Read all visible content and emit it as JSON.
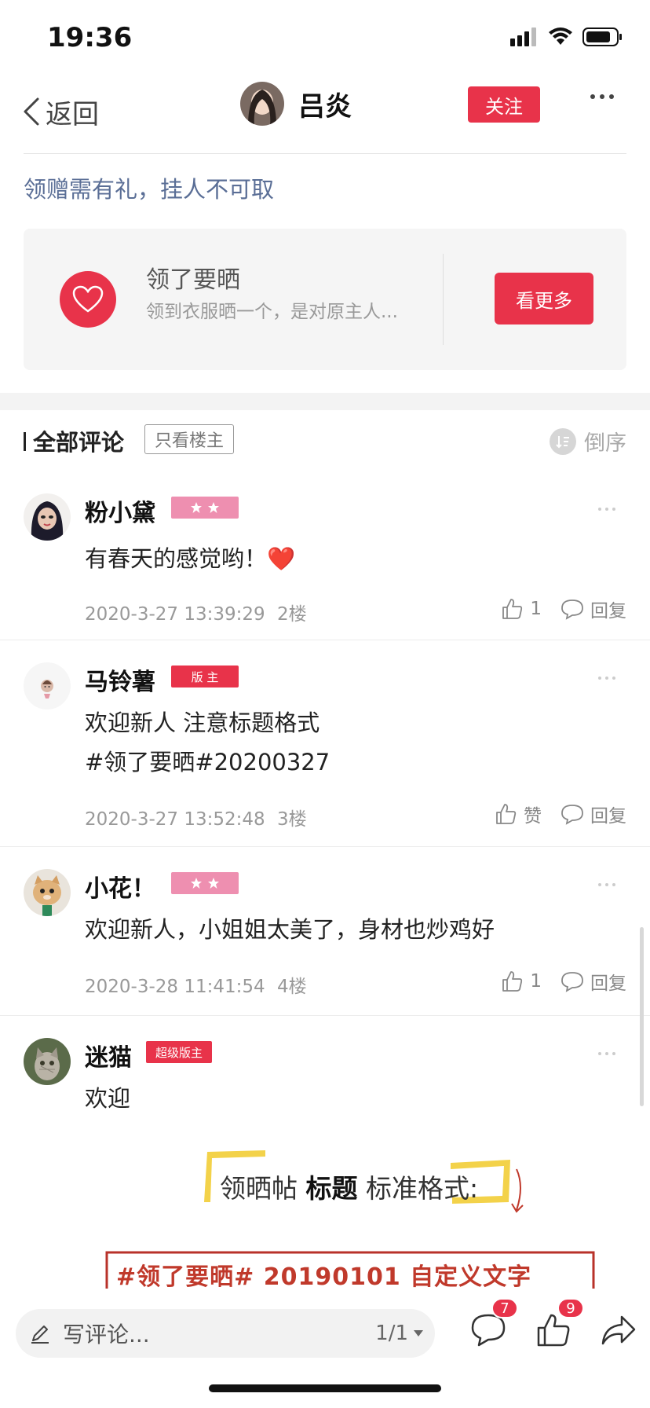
{
  "status_bar": {
    "time": "19:36"
  },
  "nav": {
    "back_label": "返回",
    "user_name": "吕炎",
    "follow_label": "关注"
  },
  "notice": "领赠需有礼，挂人不可取",
  "promo": {
    "title": "领了要晒",
    "description": "领到衣服晒一个，是对原主人...",
    "button_label": "看更多"
  },
  "comments_header": {
    "title": "全部评论",
    "filter_label": "只看楼主",
    "sort_label": "倒序"
  },
  "comments": [
    {
      "name": "粉小黛",
      "badge": "",
      "stars": 2,
      "lines": [
        "有春天的感觉哟！❤️"
      ],
      "time": "2020-3-27 13:39:29",
      "floor": "2楼",
      "likes": "1",
      "reply": "回复"
    },
    {
      "name": "马铃薯",
      "badge": "版  主",
      "stars": 0,
      "lines": [
        "欢迎新人 注意标题格式",
        "#领了要晒#20200327"
      ],
      "time": "2020-3-27 13:52:48",
      "floor": "3楼",
      "likes": "赞",
      "reply": "回复"
    },
    {
      "name": "小花！",
      "badge": "",
      "stars": 2,
      "lines": [
        "欢迎新人，小姐姐太美了，身材也炒鸡好"
      ],
      "time": "2020-3-28 11:41:54",
      "floor": "4楼",
      "likes": "1",
      "reply": "回复"
    },
    {
      "name": "迷猫",
      "badge": "超级版主",
      "stars": 0,
      "lines": [
        "欢迎"
      ],
      "time": "",
      "floor": "",
      "likes": "",
      "reply": ""
    }
  ],
  "post_image": {
    "caption_line1_a": "领晒帖",
    "caption_line1_b": "标题",
    "caption_line1_c": "标准格式:",
    "format_example": "#领了要晒# 20190101 自定义文字"
  },
  "bottom_bar": {
    "input_placeholder": "写评论...",
    "page_indicator": "1/1",
    "comment_count": "7",
    "like_count": "9"
  },
  "colors": {
    "accent": "#e8334a",
    "star_badge": "#ee8fb0",
    "notice_text": "#5a6e96"
  }
}
